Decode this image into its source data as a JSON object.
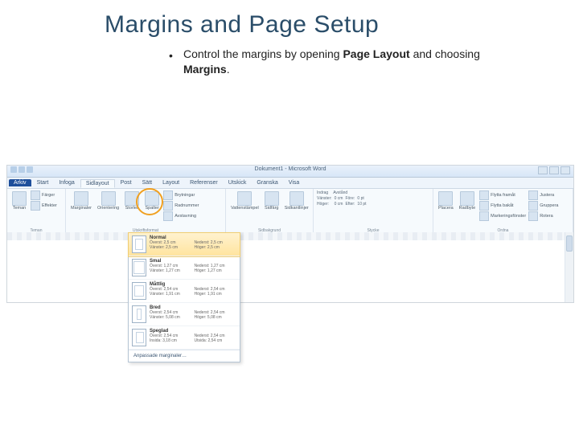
{
  "slide": {
    "title": "Margins and Page Setup",
    "bullet_prefix": "Control the margins by opening ",
    "bullet_strong1": "Page Layout",
    "bullet_mid": " and choosing ",
    "bullet_strong2": "Margins",
    "bullet_suffix": "."
  },
  "word": {
    "doc_title": "Dokument1 - Microsoft Word",
    "file_tab": "Arkiv",
    "tabs": [
      "Start",
      "Infoga",
      "Sidlayout",
      "Post",
      "Sätt",
      "Layout",
      "Referenser",
      "Utskick",
      "Granska",
      "Visa"
    ],
    "active_tab_index": 2,
    "groups": {
      "themes": {
        "label": "Teman",
        "btn_themes": "Teman",
        "btn_colors": "Färger",
        "btn_fonts": "Effekter"
      },
      "pagesetup": {
        "label": "Utskriftsformat",
        "btn_margins": "Marginaler",
        "btn_orientation": "Orientering",
        "btn_size": "Storlek",
        "btn_columns": "Spalter",
        "btn_breaks": "Brytningar",
        "btn_linenumbers": "Radnummer",
        "btn_hyphen": "Avstavning"
      },
      "pagebg": {
        "label": "Sidbakgrund",
        "btn_watermark": "Vattenstämpel",
        "btn_color": "Sidfärg",
        "btn_borders": "Sidkantlinjer"
      },
      "paragraph": {
        "label": "Stycke",
        "lbl_indent": "Indrag",
        "lbl_spacing": "Avstånd",
        "left": "Vänster:",
        "right": "Höger:",
        "before": "Före:",
        "after": "Efter:",
        "v_left": "0 cm",
        "v_right": "0 cm",
        "v_before": "0 pt",
        "v_after": "10 pt"
      },
      "arrange": {
        "label": "Ordna",
        "btn_position": "Placera",
        "btn_wrap": "Radbyte",
        "btn_forward": "Flytta framåt",
        "btn_backward": "Flytta bakåt",
        "btn_pane": "Markeringsfönster",
        "btn_align": "Justera",
        "btn_group": "Gruppera",
        "btn_rotate": "Rotera"
      }
    },
    "dropdown": {
      "options": [
        {
          "key": "normal",
          "name": "Normal",
          "top": "Överst: 2,5 cm",
          "bottom": "Nederst: 2,5 cm",
          "left": "Vänster: 2,5 cm",
          "right": "Höger: 2,5 cm"
        },
        {
          "key": "narrow",
          "name": "Smal",
          "top": "Överst: 1,27 cm",
          "bottom": "Nederst: 1,27 cm",
          "left": "Vänster: 1,27 cm",
          "right": "Höger: 1,27 cm"
        },
        {
          "key": "moderate",
          "name": "Måttlig",
          "top": "Överst: 2,54 cm",
          "bottom": "Nederst: 2,54 cm",
          "left": "Vänster: 1,91 cm",
          "right": "Höger: 1,91 cm"
        },
        {
          "key": "wide",
          "name": "Bred",
          "top": "Överst: 2,54 cm",
          "bottom": "Nederst: 2,54 cm",
          "left": "Vänster: 5,08 cm",
          "right": "Höger: 5,08 cm"
        },
        {
          "key": "mirror",
          "name": "Speglad",
          "top": "Överst: 2,54 cm",
          "bottom": "Nederst: 2,54 cm",
          "left": "Insida: 3,18 cm",
          "right": "Utsida: 2,54 cm"
        }
      ],
      "selected_index": 0,
      "custom": "Anpassade marginaler…"
    }
  }
}
